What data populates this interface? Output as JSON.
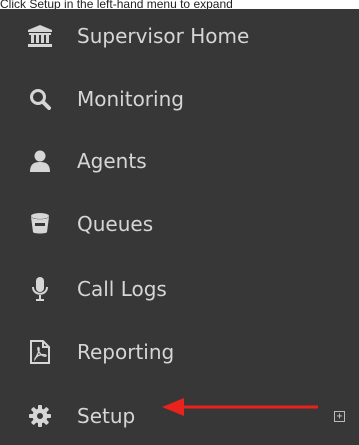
{
  "caption": "Click Setup in the left-hand menu to expand",
  "menu": {
    "items": [
      {
        "label": "Supervisor Home",
        "icon": "bank-icon"
      },
      {
        "label": "Monitoring",
        "icon": "search-icon"
      },
      {
        "label": "Agents",
        "icon": "user-icon"
      },
      {
        "label": "Queues",
        "icon": "queue-bucket-icon"
      },
      {
        "label": "Call Logs",
        "icon": "microphone-icon"
      },
      {
        "label": "Reporting",
        "icon": "pdf-file-icon"
      },
      {
        "label": "Setup",
        "icon": "gear-icon"
      }
    ],
    "expand_symbol": "+"
  },
  "colors": {
    "background": "#373737",
    "text": "#d6d6d6",
    "annotation_arrow": "#e8231b"
  }
}
